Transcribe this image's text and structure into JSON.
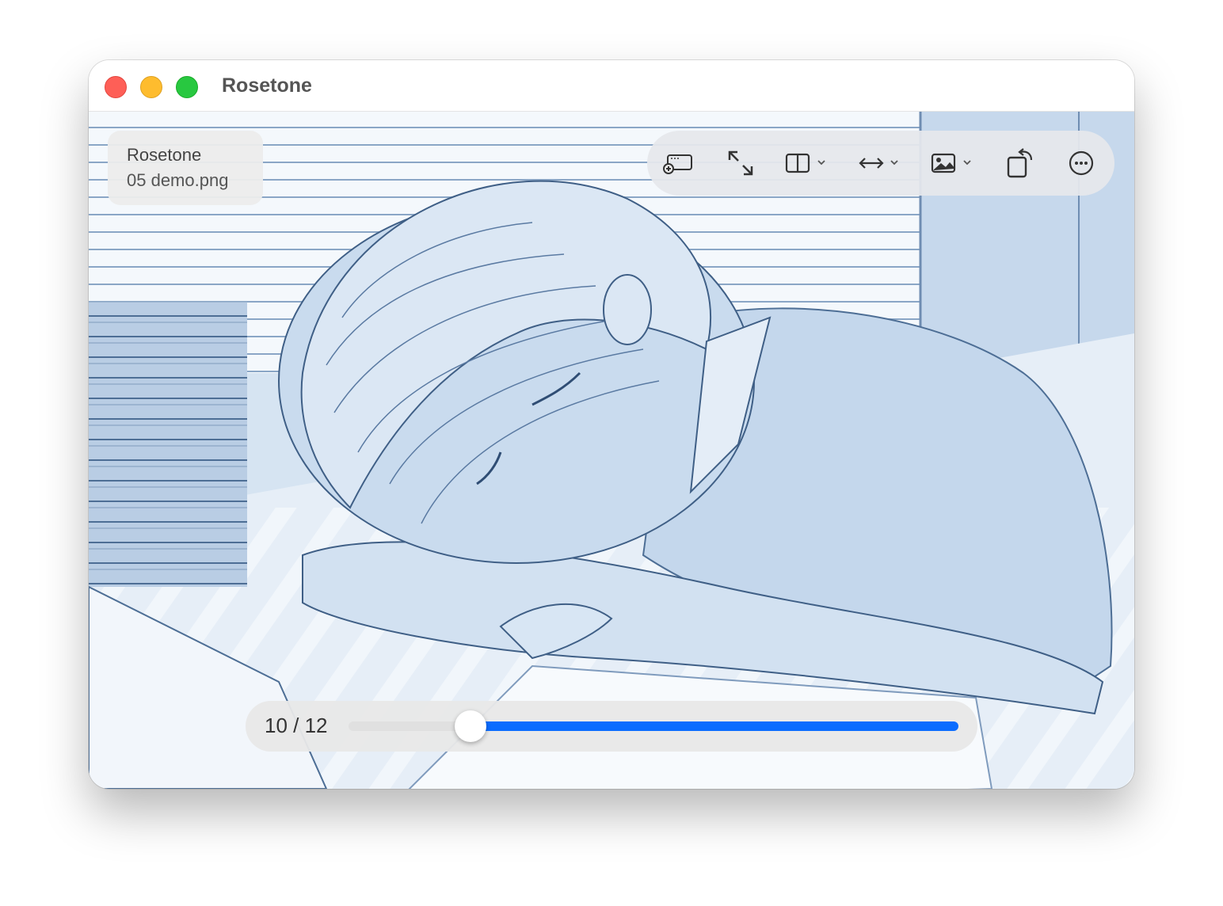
{
  "window": {
    "title": "Rosetone"
  },
  "info": {
    "app_name": "Rosetone",
    "file_name": "05 demo.png"
  },
  "toolbar": {
    "buttons": [
      {
        "name": "add-caption-icon"
      },
      {
        "name": "fullscreen-expand-icon"
      },
      {
        "name": "split-view-icon"
      },
      {
        "name": "fit-width-icon"
      },
      {
        "name": "image-options-icon"
      },
      {
        "name": "rotate-icon"
      },
      {
        "name": "more-options-icon"
      }
    ]
  },
  "scrubber": {
    "counter": "10 / 12",
    "current": 10,
    "total": 12,
    "position_fraction": 0.2
  },
  "colors": {
    "accent": "#0a6cff",
    "close": "#fe5f57",
    "minimize": "#febc2e",
    "maximize": "#28c840"
  }
}
